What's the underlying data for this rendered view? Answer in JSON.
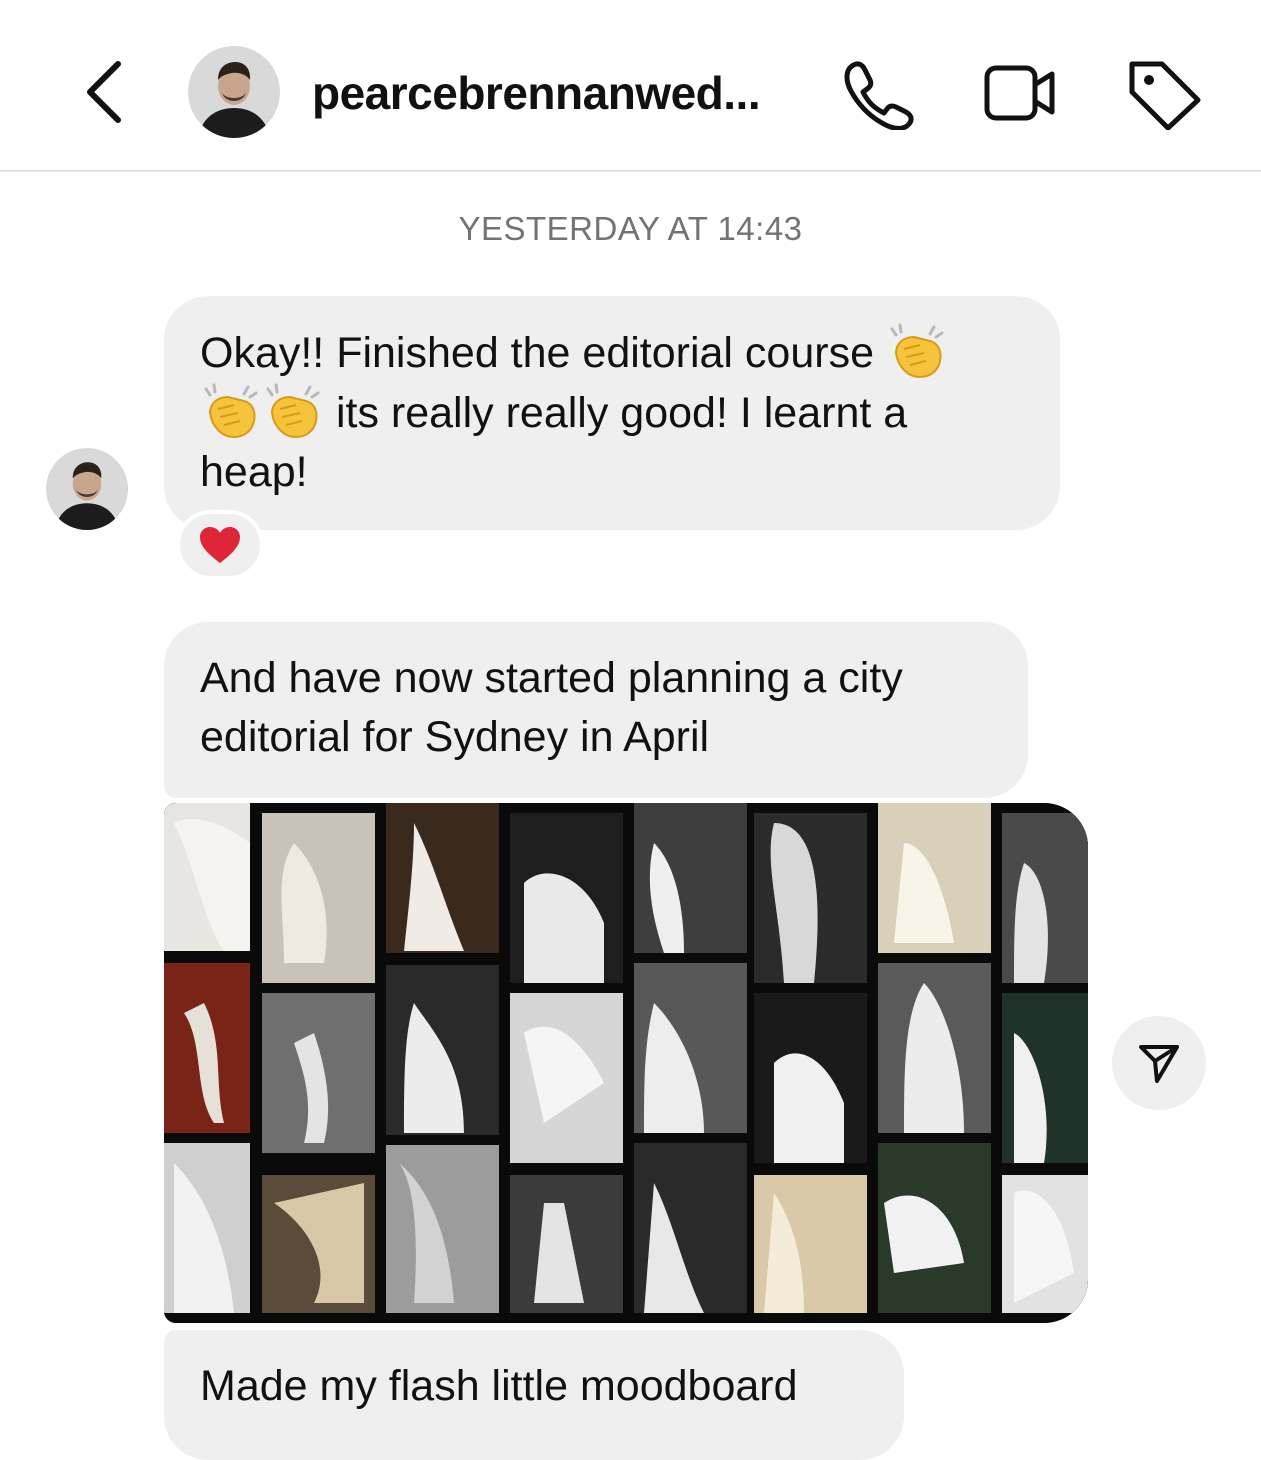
{
  "header": {
    "contact_name": "pearcebrennanwed...",
    "icons": [
      "back-chevron-icon",
      "phone-icon",
      "video-camera-icon",
      "tag-icon"
    ]
  },
  "thread": {
    "timestamp": "YESTERDAY AT 14:43",
    "messages": [
      {
        "line1": "Okay!! Finished the editorial course",
        "line2": "its really really good! I learnt a",
        "line3": "heap!",
        "reaction": "heart"
      },
      {
        "line1": "And have now started planning a city",
        "line2": "editorial for Sydney in April"
      },
      {
        "type": "image",
        "alt": "wedding editorial moodboard collage"
      },
      {
        "line1": "Made my flash little moodboard"
      }
    ]
  },
  "colors": {
    "bubble": "#efefef",
    "timestamp": "#737373",
    "heart": "#e0243a",
    "clap": "#f6c43a"
  }
}
